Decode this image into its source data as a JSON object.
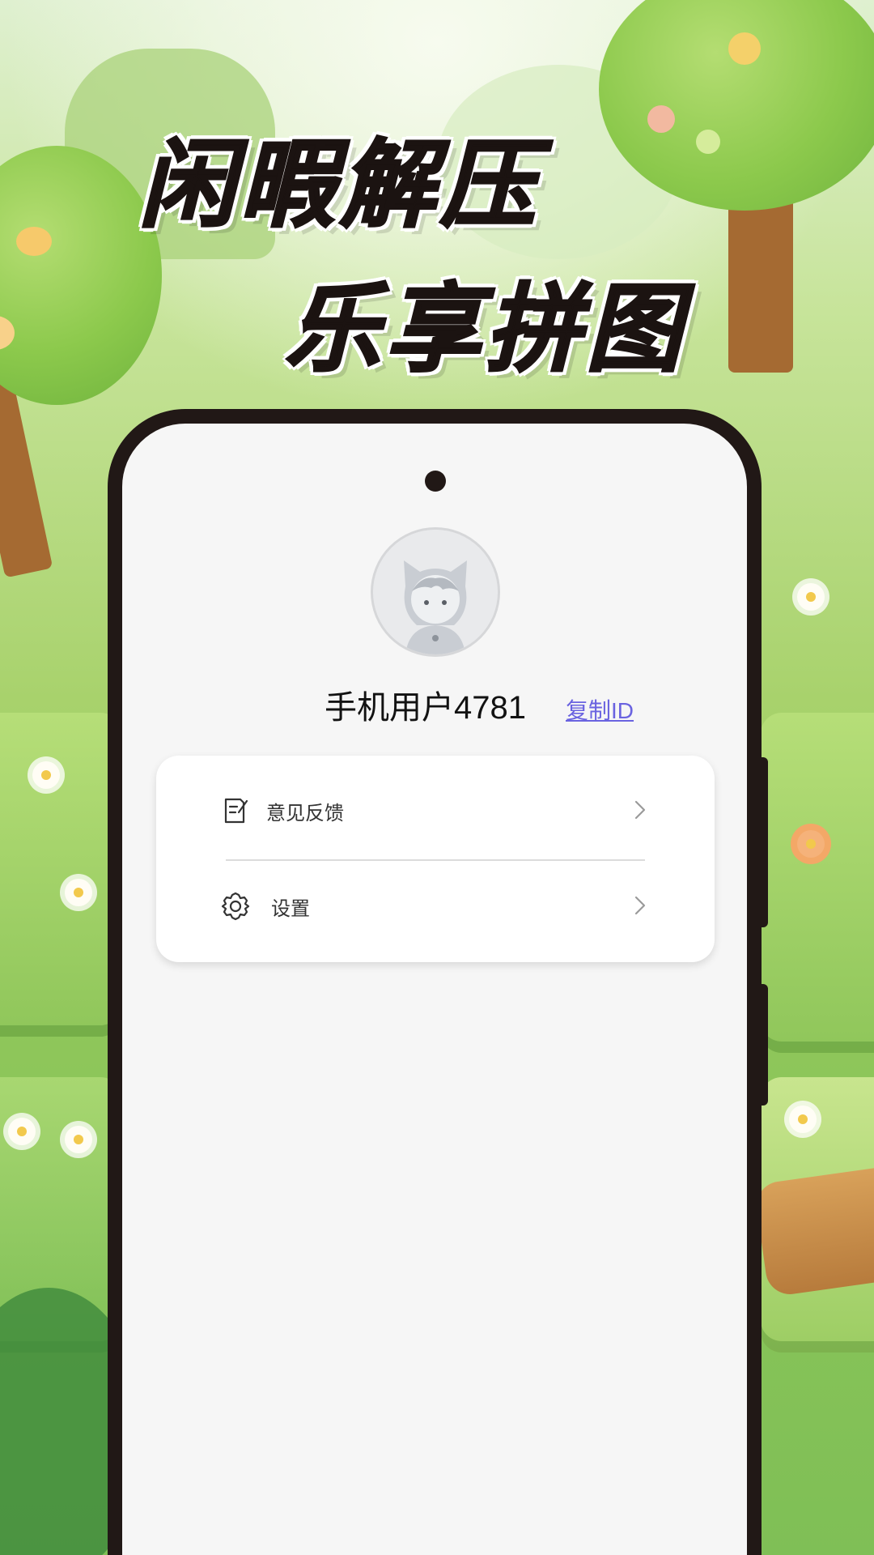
{
  "banner": {
    "line1": "闲暇解压",
    "line2": "乐享拼图"
  },
  "profile": {
    "username": "手机用户4781",
    "copy_id_label": "复制ID",
    "avatar_icon": "default-avatar-icon"
  },
  "menu": {
    "items": [
      {
        "label": "意见反馈",
        "icon": "feedback-icon"
      },
      {
        "label": "设置",
        "icon": "gear-icon"
      }
    ]
  },
  "colors": {
    "link": "#6a63e0",
    "phone_frame": "#211816",
    "screen_bg": "#f6f6f6",
    "headline": "#1b1311"
  }
}
